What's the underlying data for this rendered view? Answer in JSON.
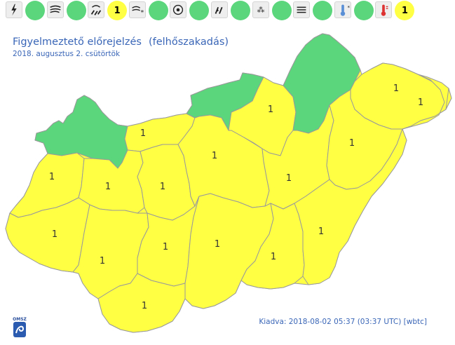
{
  "colors": {
    "green": "#5bd67c",
    "yellow": "#ffff44",
    "text_blue": "#3a66b7",
    "border": "#a0a0a0"
  },
  "toolbar": [
    {
      "icon": "lightning-icon",
      "level": "",
      "color": "green"
    },
    {
      "icon": "wind-icon",
      "level": "",
      "color": "green"
    },
    {
      "icon": "cloudburst-icon",
      "level": "1",
      "color": "yellow"
    },
    {
      "icon": "snowstorm-icon",
      "level": "",
      "color": "green"
    },
    {
      "icon": "freezing-rain-icon",
      "level": "",
      "color": "green"
    },
    {
      "icon": "slippery-road-icon",
      "level": "",
      "color": "green"
    },
    {
      "icon": "snow-icon",
      "level": "",
      "color": "green"
    },
    {
      "icon": "fog-icon",
      "level": "",
      "color": "green"
    },
    {
      "icon": "cold-icon",
      "level": "",
      "color": "green"
    },
    {
      "icon": "heat-icon",
      "level": "1",
      "color": "yellow"
    }
  ],
  "header": {
    "title": "Figyelmeztető előrejelzés",
    "subtitle": "(felhőszakadás)",
    "date": "2018. augusztus 2. csütörtök"
  },
  "footer": {
    "issued": "Kiadva: 2018-08-02 05:37 (03:37 UTC) [wbtc]",
    "logo_text": "OMSZ"
  },
  "counties": [
    {
      "name": "gyor-moson-sopron",
      "level": "",
      "color": "green"
    },
    {
      "name": "komarom-esztergom",
      "level": "1",
      "color": "yellow"
    },
    {
      "name": "pest-north",
      "level": "",
      "color": "green"
    },
    {
      "name": "nograd",
      "level": "1",
      "color": "yellow"
    },
    {
      "name": "borsod-abauj-zemplen",
      "level": "",
      "color": "green"
    },
    {
      "name": "szabolcs-szatmar-bereg",
      "level": "1",
      "color": "yellow"
    },
    {
      "name": "vas",
      "level": "1",
      "color": "yellow"
    },
    {
      "name": "veszprem",
      "level": "1",
      "color": "yellow"
    },
    {
      "name": "fejer",
      "level": "1",
      "color": "yellow"
    },
    {
      "name": "pest",
      "level": "1",
      "color": "yellow"
    },
    {
      "name": "heves",
      "level": "1",
      "color": "yellow"
    },
    {
      "name": "jasz-nagykun-szolnok",
      "level": "1",
      "color": "yellow"
    },
    {
      "name": "hajdu-bihar",
      "level": "1",
      "color": "yellow"
    },
    {
      "name": "zala",
      "level": "1",
      "color": "yellow"
    },
    {
      "name": "somogy",
      "level": "1",
      "color": "yellow"
    },
    {
      "name": "tolna",
      "level": "1",
      "color": "yellow"
    },
    {
      "name": "bacs-kiskun",
      "level": "1",
      "color": "yellow"
    },
    {
      "name": "csongrad",
      "level": "1",
      "color": "yellow"
    },
    {
      "name": "bekes",
      "level": "1",
      "color": "yellow"
    },
    {
      "name": "baranya",
      "level": "1",
      "color": "yellow"
    }
  ]
}
